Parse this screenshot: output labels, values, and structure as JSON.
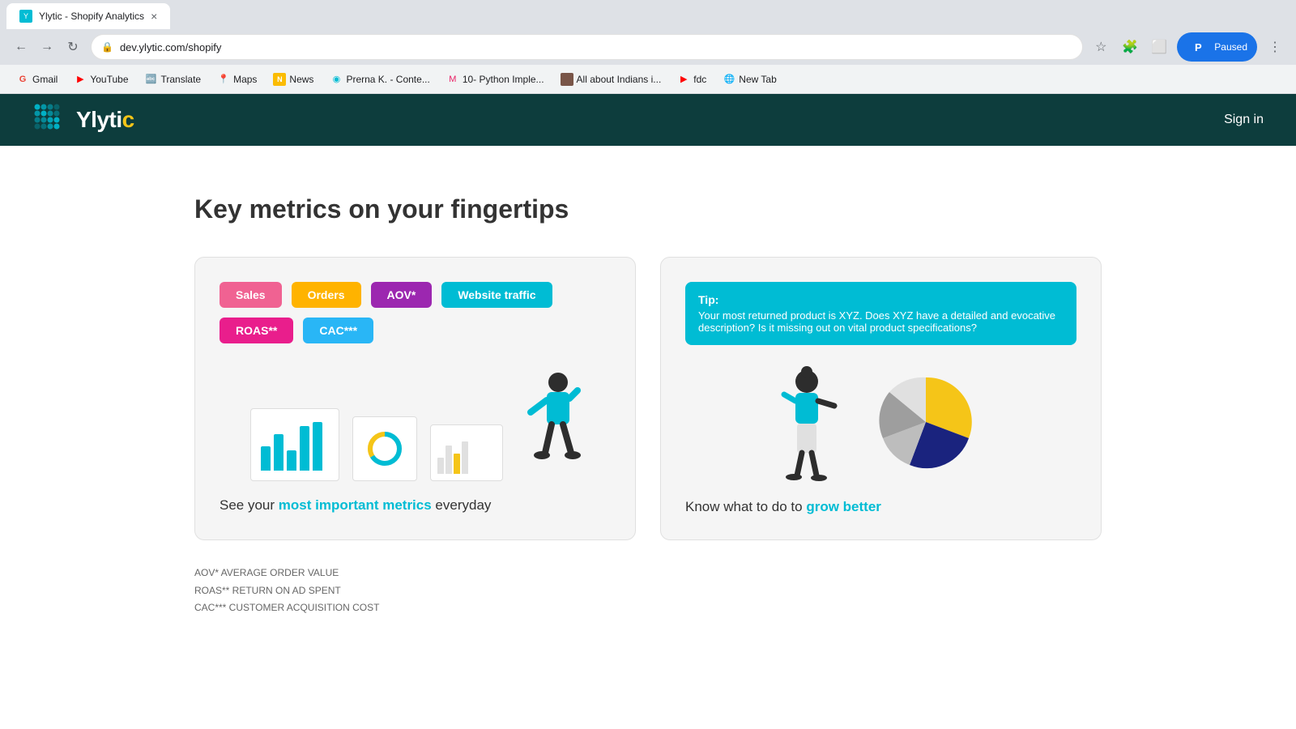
{
  "browser": {
    "url": "dev.ylytic.com/shopify",
    "tab_title": "Ylytic - Shopify Analytics",
    "nav_back": "←",
    "nav_forward": "→",
    "refresh": "↻",
    "profile_initial": "P",
    "paused_label": "Paused",
    "bookmarks": [
      {
        "name": "Gmail",
        "icon": "G",
        "color": "#ea4335",
        "label": "Gmail"
      },
      {
        "name": "YouTube",
        "icon": "▶",
        "color": "#ff0000",
        "label": "YouTube"
      },
      {
        "name": "Translate",
        "icon": "T",
        "color": "#4285f4",
        "label": "Translate"
      },
      {
        "name": "Maps",
        "icon": "◉",
        "color": "#34a853",
        "label": "Maps"
      },
      {
        "name": "News",
        "icon": "N",
        "color": "#fbbc04",
        "label": "News"
      },
      {
        "name": "Prerna K",
        "icon": "P",
        "color": "#00bcd4",
        "label": "Prerna K. - Conte..."
      },
      {
        "name": "Python",
        "icon": "M",
        "color": "#e91e63",
        "label": "10- Python Imple..."
      },
      {
        "name": "Indians",
        "icon": "I",
        "color": "#795548",
        "label": "All about Indians i..."
      },
      {
        "name": "fdc",
        "icon": "▶",
        "color": "#ff0000",
        "label": "fdc"
      },
      {
        "name": "NewTab",
        "icon": "✦",
        "color": "#5f6368",
        "label": "New Tab"
      }
    ]
  },
  "header": {
    "logo_text_white": "Ylytic",
    "logo_text_yellow": "c",
    "logo_base": "Ylyti",
    "sign_in": "Sign in"
  },
  "main": {
    "title": "Key metrics on your fingertips",
    "card1": {
      "tags": [
        {
          "label": "Sales",
          "class": "tag-sales"
        },
        {
          "label": "Orders",
          "class": "tag-orders"
        },
        {
          "label": "AOV*",
          "class": "tag-aov"
        },
        {
          "label": "Website traffic",
          "class": "tag-website"
        },
        {
          "label": "ROAS**",
          "class": "tag-roas"
        },
        {
          "label": "CAC***",
          "class": "tag-cac"
        }
      ],
      "caption_before": "See your ",
      "caption_highlight": "most important metrics",
      "caption_after": " everyday"
    },
    "card2": {
      "tip_label": "Tip:",
      "tip_text": "Your most returned product is XYZ. Does XYZ have a detailed and evocative description? Is it missing out on vital product specifications?",
      "caption_before": "Know what to do to ",
      "caption_highlight": "grow better"
    },
    "footnotes": [
      "AOV* AVERAGE ORDER VALUE",
      "ROAS** RETURN ON AD SPENT",
      "CAC*** CUSTOMER ACQUISITION COST"
    ]
  }
}
